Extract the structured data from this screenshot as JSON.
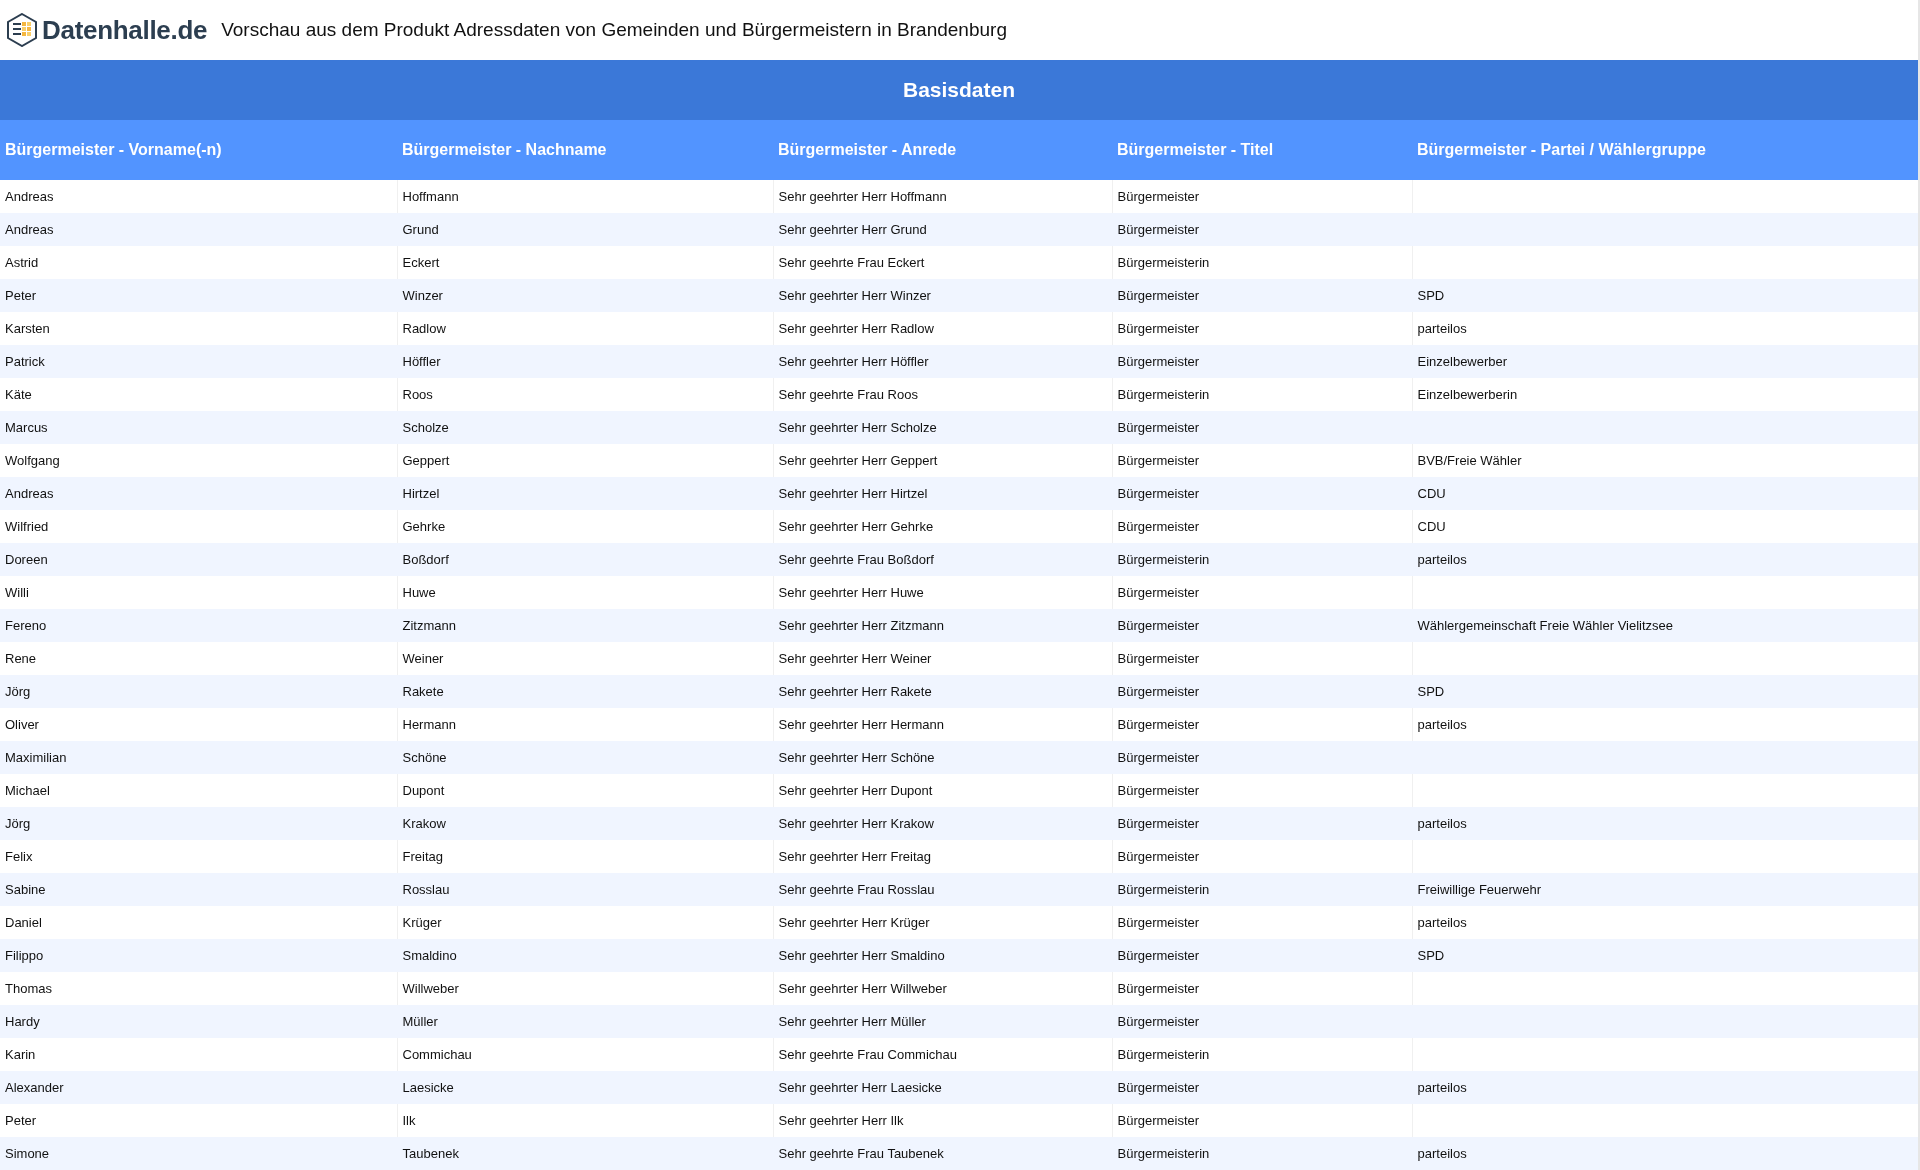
{
  "header": {
    "logo_text": "Datenhalle.de",
    "title": "Vorschau aus dem Produkt Adressdaten von Gemeinden und Bürgermeistern in Brandenburg"
  },
  "table": {
    "group_title": "Basisdaten",
    "columns": [
      "Bürgermeister - Vorname(-n)",
      "Bürgermeister - Nachname",
      "Bürgermeister - Anrede",
      "Bürgermeister - Titel",
      "Bürgermeister - Partei / Wählergruppe"
    ],
    "rows": [
      [
        "Andreas",
        "Hoffmann",
        "Sehr geehrter Herr Hoffmann",
        "Bürgermeister",
        ""
      ],
      [
        "Andreas",
        "Grund",
        "Sehr geehrter Herr Grund",
        "Bürgermeister",
        ""
      ],
      [
        "Astrid",
        "Eckert",
        "Sehr geehrte Frau Eckert",
        "Bürgermeisterin",
        ""
      ],
      [
        "Peter",
        "Winzer",
        "Sehr geehrter Herr Winzer",
        "Bürgermeister",
        "SPD"
      ],
      [
        "Karsten",
        "Radlow",
        "Sehr geehrter Herr Radlow",
        "Bürgermeister",
        "parteilos"
      ],
      [
        "Patrick",
        "Höffler",
        "Sehr geehrter Herr Höffler",
        "Bürgermeister",
        "Einzelbewerber"
      ],
      [
        "Käte",
        "Roos",
        "Sehr geehrte Frau Roos",
        "Bürgermeisterin",
        "Einzelbewerberin"
      ],
      [
        "Marcus",
        "Scholze",
        "Sehr geehrter Herr Scholze",
        "Bürgermeister",
        ""
      ],
      [
        "Wolfgang",
        "Geppert",
        "Sehr geehrter Herr Geppert",
        "Bürgermeister",
        "BVB/Freie Wähler"
      ],
      [
        "Andreas",
        "Hirtzel",
        "Sehr geehrter Herr Hirtzel",
        "Bürgermeister",
        "CDU"
      ],
      [
        "Wilfried",
        "Gehrke",
        "Sehr geehrter Herr Gehrke",
        "Bürgermeister",
        "CDU"
      ],
      [
        "Doreen",
        "Boßdorf",
        "Sehr geehrte Frau Boßdorf",
        "Bürgermeisterin",
        "parteilos"
      ],
      [
        "Willi",
        "Huwe",
        "Sehr geehrter Herr Huwe",
        "Bürgermeister",
        ""
      ],
      [
        "Fereno",
        "Zitzmann",
        "Sehr geehrter Herr Zitzmann",
        "Bürgermeister",
        "Wählergemeinschaft Freie Wähler Vielitzsee"
      ],
      [
        "Rene",
        "Weiner",
        "Sehr geehrter Herr Weiner",
        "Bürgermeister",
        ""
      ],
      [
        "Jörg",
        "Rakete",
        "Sehr geehrter Herr Rakete",
        "Bürgermeister",
        "SPD"
      ],
      [
        "Oliver",
        "Hermann",
        "Sehr geehrter Herr Hermann",
        "Bürgermeister",
        "parteilos"
      ],
      [
        "Maximilian",
        "Schöne",
        "Sehr geehrter Herr Schöne",
        "Bürgermeister",
        ""
      ],
      [
        "Michael",
        "Dupont",
        "Sehr geehrter Herr Dupont",
        "Bürgermeister",
        ""
      ],
      [
        "Jörg",
        "Krakow",
        "Sehr geehrter Herr Krakow",
        "Bürgermeister",
        "parteilos"
      ],
      [
        "Felix",
        "Freitag",
        "Sehr geehrter Herr Freitag",
        "Bürgermeister",
        ""
      ],
      [
        "Sabine",
        "Rosslau",
        "Sehr geehrte Frau Rosslau",
        "Bürgermeisterin",
        "Freiwillige Feuerwehr"
      ],
      [
        "Daniel",
        "Krüger",
        "Sehr geehrter Herr Krüger",
        "Bürgermeister",
        "parteilos"
      ],
      [
        "Filippo",
        "Smaldino",
        "Sehr geehrter Herr Smaldino",
        "Bürgermeister",
        "SPD"
      ],
      [
        "Thomas",
        "Willweber",
        "Sehr geehrter Herr Willweber",
        "Bürgermeister",
        ""
      ],
      [
        "Hardy",
        "Müller",
        "Sehr geehrter Herr Müller",
        "Bürgermeister",
        ""
      ],
      [
        "Karin",
        "Commichau",
        "Sehr geehrte Frau Commichau",
        "Bürgermeisterin",
        ""
      ],
      [
        "Alexander",
        "Laesicke",
        "Sehr geehrter Herr Laesicke",
        "Bürgermeister",
        "parteilos"
      ],
      [
        "Peter",
        "Ilk",
        "Sehr geehrter Herr Ilk",
        "Bürgermeister",
        ""
      ],
      [
        "Simone",
        "Taubenek",
        "Sehr geehrte Frau Taubenek",
        "Bürgermeisterin",
        "parteilos"
      ]
    ]
  }
}
